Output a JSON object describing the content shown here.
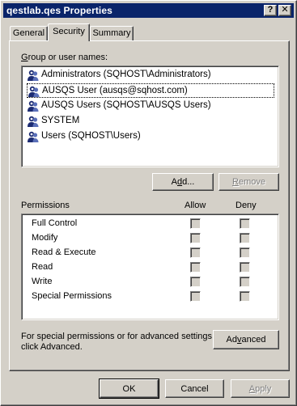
{
  "window": {
    "title": "qestlab.qes Properties"
  },
  "titlebar_buttons": {
    "help": "?",
    "close": "✕"
  },
  "tabs": [
    {
      "label": "General",
      "active": false
    },
    {
      "label": "Security",
      "active": true
    },
    {
      "label": "Summary",
      "active": false
    }
  ],
  "security": {
    "group_label_prefix": "",
    "group_label_mnemonic": "G",
    "group_label_rest": "roup or user names:",
    "users": [
      {
        "name": "Administrators (SQHOST\\Administrators)",
        "focused": false
      },
      {
        "name": "AUSQS User (ausqs@sqhost.com)",
        "focused": true
      },
      {
        "name": "AUSQS Users (SQHOST\\AUSQS Users)",
        "focused": false
      },
      {
        "name": "SYSTEM",
        "focused": false
      },
      {
        "name": "Users (SQHOST\\Users)",
        "focused": false
      }
    ],
    "add_button": {
      "prefix": "A",
      "mnemonic": "d",
      "rest": "d..."
    },
    "remove_button": {
      "prefix": "",
      "mnemonic": "R",
      "rest": "emove",
      "enabled": false
    },
    "permissions_header": {
      "label": "Permissions",
      "allow": "Allow",
      "deny": "Deny"
    },
    "permissions": [
      {
        "name": "Full Control",
        "allow": false,
        "deny": false
      },
      {
        "name": "Modify",
        "allow": false,
        "deny": false
      },
      {
        "name": "Read & Execute",
        "allow": false,
        "deny": false
      },
      {
        "name": "Read",
        "allow": false,
        "deny": false
      },
      {
        "name": "Write",
        "allow": false,
        "deny": false
      },
      {
        "name": "Special Permissions",
        "allow": false,
        "deny": false
      }
    ],
    "advanced_note_line1": "For special permissions or for advanced settings,",
    "advanced_note_line2": "click Advanced.",
    "advanced_button": {
      "prefix": "Ad",
      "mnemonic": "v",
      "rest": "anced"
    }
  },
  "footer": {
    "ok": "OK",
    "cancel": "Cancel",
    "apply": {
      "prefix": "",
      "mnemonic": "A",
      "rest": "pply",
      "enabled": false
    }
  }
}
